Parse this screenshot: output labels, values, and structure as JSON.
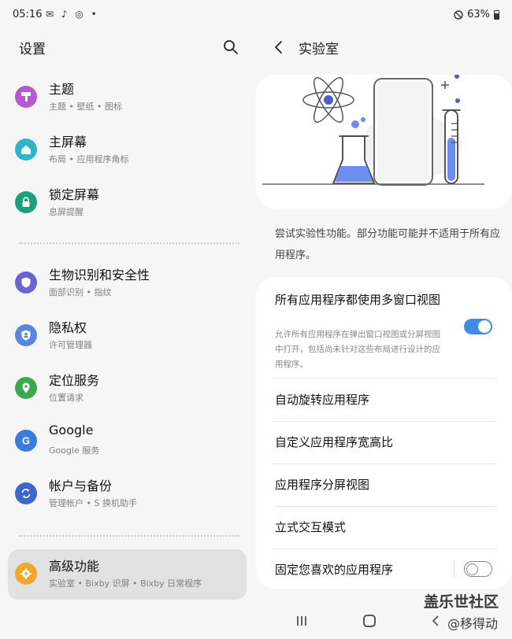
{
  "status": {
    "time": "05:16",
    "notif_icons": "✉ ♪ ◎ •",
    "battery": "63%"
  },
  "left": {
    "title": "设置",
    "menu": [
      {
        "title": "主题",
        "sub": "主题 • 壁纸 • 图标",
        "icon": "theme-icon",
        "color": "#b45ad0"
      },
      {
        "title": "主屏幕",
        "sub": "布局 • 应用程序角标",
        "icon": "home-icon",
        "color": "#2db6c8"
      },
      {
        "title": "锁定屏幕",
        "sub": "息屏提醒",
        "icon": "lock-icon",
        "color": "#1e9e7d"
      },
      {
        "title": "生物识别和安全性",
        "sub": "面部识别 • 指纹",
        "icon": "shield-icon",
        "color": "#6a63d6"
      },
      {
        "title": "隐私权",
        "sub": "许可管理器",
        "icon": "privacy-icon",
        "color": "#5b85e0"
      },
      {
        "title": "定位服务",
        "sub": "位置请求",
        "icon": "location-pin-icon",
        "color": "#3aa851"
      },
      {
        "title": "Google",
        "sub": "Google 服务",
        "icon": "google-icon",
        "color": "#3a7be0"
      },
      {
        "title": "帐户与备份",
        "sub": "管理帐户 • S 换机助手",
        "icon": "sync-icon",
        "color": "#3f66cc"
      },
      {
        "title": "高级功能",
        "sub": "实验室 • Bixby 识屏 • Bixby 日常程序",
        "icon": "gear-plus-icon",
        "color": "#f1a72a"
      }
    ]
  },
  "right": {
    "title": "实验室",
    "description": "尝试实验性功能。部分功能可能并不适用于所有应用程序。",
    "settings": [
      {
        "title": "所有应用程序都使用多窗口视图",
        "desc": "允许所有应用程序在弹出窗口视图或分屏视图中打开，包括尚未针对这些布局进行设计的应用程序。",
        "toggle": "on"
      },
      {
        "title": "自动旋转应用程序"
      },
      {
        "title": "自定义应用程序宽高比"
      },
      {
        "title": "应用程序分屏视图"
      },
      {
        "title": "立式交互模式"
      },
      {
        "title": "固定您喜欢的应用程序",
        "toggle": "off"
      }
    ]
  },
  "watermark": {
    "top": "盖乐世社区",
    "bottom": "@移得动"
  },
  "colors": {
    "accent": "#3e8bea",
    "flask_blue": "#6d8ef0"
  }
}
